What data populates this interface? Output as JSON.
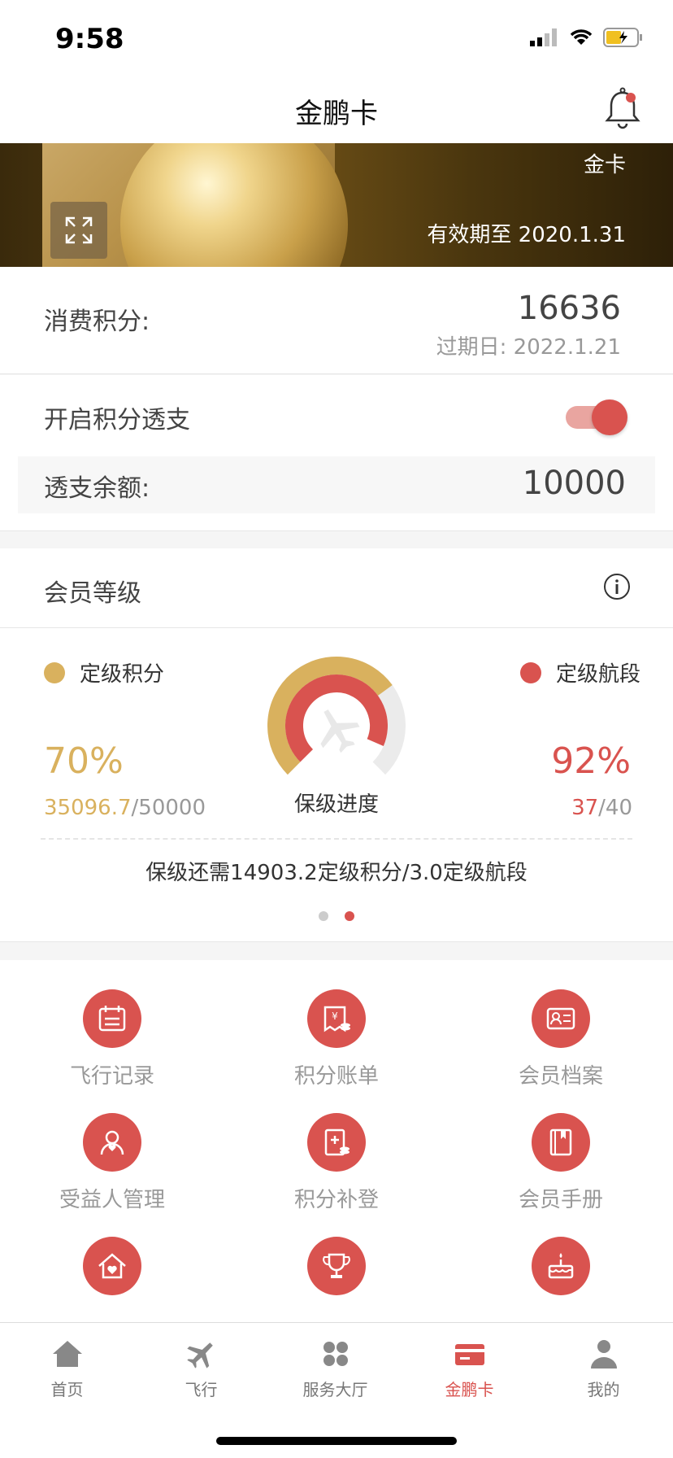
{
  "status_bar": {
    "time": "9:58"
  },
  "nav": {
    "title": "金鹏卡"
  },
  "card": {
    "level": "金卡",
    "validity": "有效期至 2020.1.31"
  },
  "points": {
    "label": "消费积分:",
    "value": "16636",
    "expiry": "过期日: 2022.1.21"
  },
  "overdraft": {
    "toggle_label": "开启积分透支",
    "toggle_on": true,
    "balance_label": "透支余额:",
    "balance_value": "10000"
  },
  "member_level": {
    "title": "会员等级",
    "left": {
      "legend": "定级积分",
      "percent": "70%",
      "current": "35096.7",
      "total": "/50000",
      "color": "#d9b15e"
    },
    "right": {
      "legend": "定级航段",
      "percent": "92%",
      "current": "37",
      "total": "/40",
      "color": "#d9534f"
    },
    "gauge_label": "保级进度",
    "outer_progress": 0.7,
    "inner_progress": 0.92,
    "requirement": "保级还需14903.2定级积分/3.0定级航段",
    "pager_active": 1
  },
  "grid": [
    {
      "label": "飞行记录",
      "icon": "calendar-icon"
    },
    {
      "label": "积分账单",
      "icon": "points-bill-icon"
    },
    {
      "label": "会员档案",
      "icon": "id-card-icon"
    },
    {
      "label": "受益人管理",
      "icon": "beneficiary-icon"
    },
    {
      "label": "积分补登",
      "icon": "points-supplement-icon"
    },
    {
      "label": "会员手册",
      "icon": "handbook-icon"
    },
    {
      "label": "",
      "icon": "home-heart-icon"
    },
    {
      "label": "",
      "icon": "trophy-icon"
    },
    {
      "label": "",
      "icon": "birthday-cake-icon"
    }
  ],
  "tabs": [
    {
      "label": "首页",
      "icon": "home-icon"
    },
    {
      "label": "飞行",
      "icon": "plane-icon"
    },
    {
      "label": "服务大厅",
      "icon": "grid-dots-icon"
    },
    {
      "label": "金鹏卡",
      "icon": "card-icon",
      "active": true
    },
    {
      "label": "我的",
      "icon": "person-icon"
    }
  ],
  "colors": {
    "accent": "#d9534f",
    "gold": "#d9b15e"
  }
}
